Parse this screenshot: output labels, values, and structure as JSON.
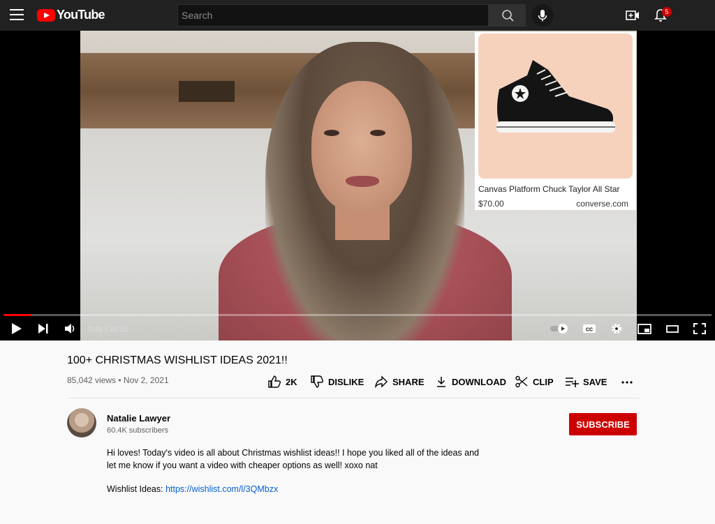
{
  "header": {
    "logo_text": "YouTube",
    "search_placeholder": "Search",
    "notification_count": "5"
  },
  "player": {
    "product": {
      "name": "Canvas Platform Chuck Taylor All Star",
      "price": "$70.00",
      "site": "converse.com"
    },
    "time_display": "0:48 / 20:51",
    "progress_fraction": 0.038
  },
  "video": {
    "title": "100+ CHRISTMAS WISHLIST IDEAS 2021!!",
    "meta": "85,042 views • Nov 2, 2021",
    "actions": {
      "like": "2K",
      "dislike": "DISLIKE",
      "share": "SHARE",
      "download": "DOWNLOAD",
      "clip": "CLIP",
      "save": "SAVE"
    }
  },
  "channel": {
    "name": "Natalie Lawyer",
    "subscribers": "60.4K subscribers",
    "subscribe_label": "SUBSCRIBE"
  },
  "description": {
    "line1": "Hi loves! Today's video is all about Christmas wishlist ideas!! I  hope you liked all of the ideas and",
    "line2": "let me know if you want a video with cheaper options as well! xoxo nat",
    "link_label": "Wishlist Ideas: ",
    "link_url": "https://wishlist.com/l/3QMbzx"
  },
  "colors": {
    "brand_red": "#ff0000",
    "subscribe_red": "#cc0000",
    "link_blue": "#065fd4",
    "topbar_bg": "#212121"
  }
}
